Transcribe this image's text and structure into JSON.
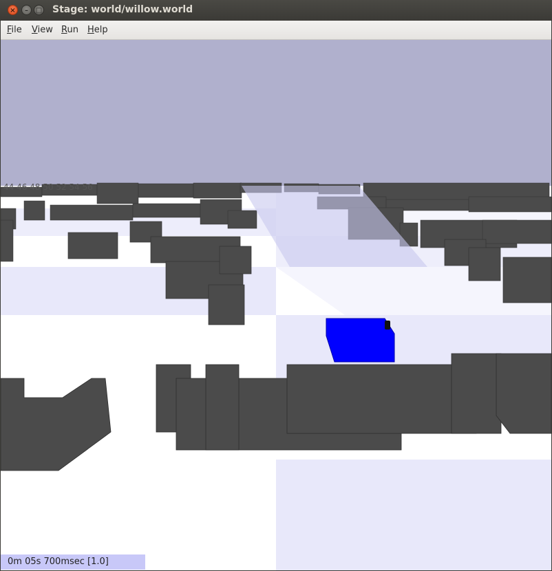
{
  "window": {
    "title": "Stage: world/willow.world",
    "close_glyph": "×",
    "minimize_glyph": "–",
    "maximize_glyph": "□"
  },
  "menu": {
    "items": [
      {
        "label_first": "F",
        "label_rest": "ile"
      },
      {
        "label_first": "V",
        "label_rest": "iew"
      },
      {
        "label_first": "R",
        "label_rest": "un"
      },
      {
        "label_first": "H",
        "label_rest": "elp"
      }
    ]
  },
  "scene": {
    "sky_color": "#b0b0cd",
    "floor_color": "#ffffff",
    "floor_tile_color": "#e6e6fa",
    "obstacle_color": "#4b4b4b",
    "robot_color": "#0000ff",
    "far_label": "44 46 48 50 52 54 56"
  },
  "status": {
    "clock": "0m 05s 700msec [1.0]"
  }
}
